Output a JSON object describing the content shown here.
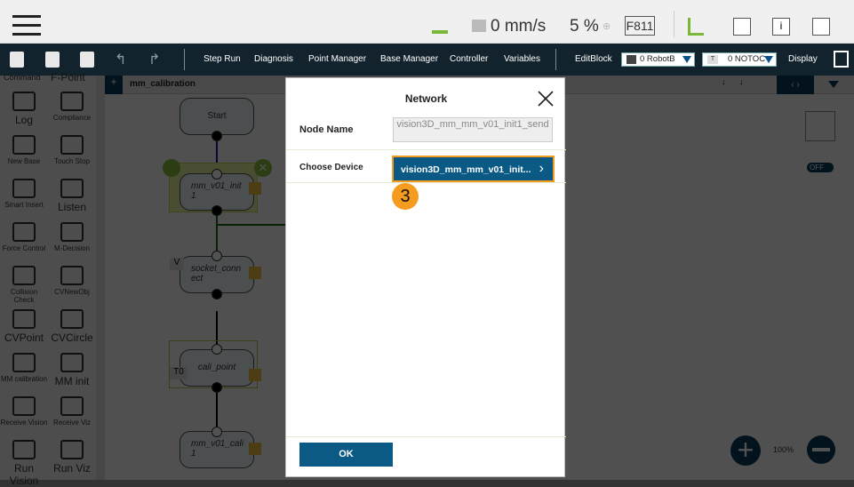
{
  "header": {
    "speed": "0 mm/s",
    "percent": "5 %",
    "fcode": "F811"
  },
  "toolbar": {
    "items": [
      "Step Run",
      "Diagnosis",
      "Point Manager",
      "Base Manager",
      "Controller",
      "Variables",
      "EditBlock"
    ],
    "robot_base": "0 RobotB",
    "tool": "0 NOTOC",
    "tool_prefix": "T",
    "display": "Display"
  },
  "sidebar": {
    "headers": [
      "Command",
      "F-Point"
    ],
    "items": [
      "Log",
      "Compliance",
      "New Base",
      "Touch Stop",
      "Smart Insert",
      "Listen",
      "Force Control",
      "M-Decision",
      "Collision Check",
      "CVNewObj",
      "CVPoint",
      "CVCircle",
      "MM calibration",
      "MM init",
      "Receive Vision",
      "Receive Viz",
      "Run Vision",
      "Run Viz"
    ]
  },
  "canvas": {
    "tab": "mm_calibration",
    "add": "+",
    "nodes": [
      "Start",
      "mm_v01_init 1",
      "socket_conn ect",
      "cali_point",
      "mm_v01_cali 1"
    ],
    "tags": [
      "V",
      "T0"
    ],
    "zoom": "100%",
    "toggle": "OFF"
  },
  "dialog": {
    "title": "Network",
    "node_name_label": "Node Name",
    "node_name_value": "vision3D_mm_mm_v01_init1_send",
    "choose_device_label": "Choose Device",
    "device_value": "vision3D_mm_mm_v01_init...",
    "step_badge": "3",
    "ok": "OK"
  },
  "colors": {
    "accent": "#0a5a85",
    "highlight": "#f39c1f",
    "toolbar": "#13232e"
  }
}
